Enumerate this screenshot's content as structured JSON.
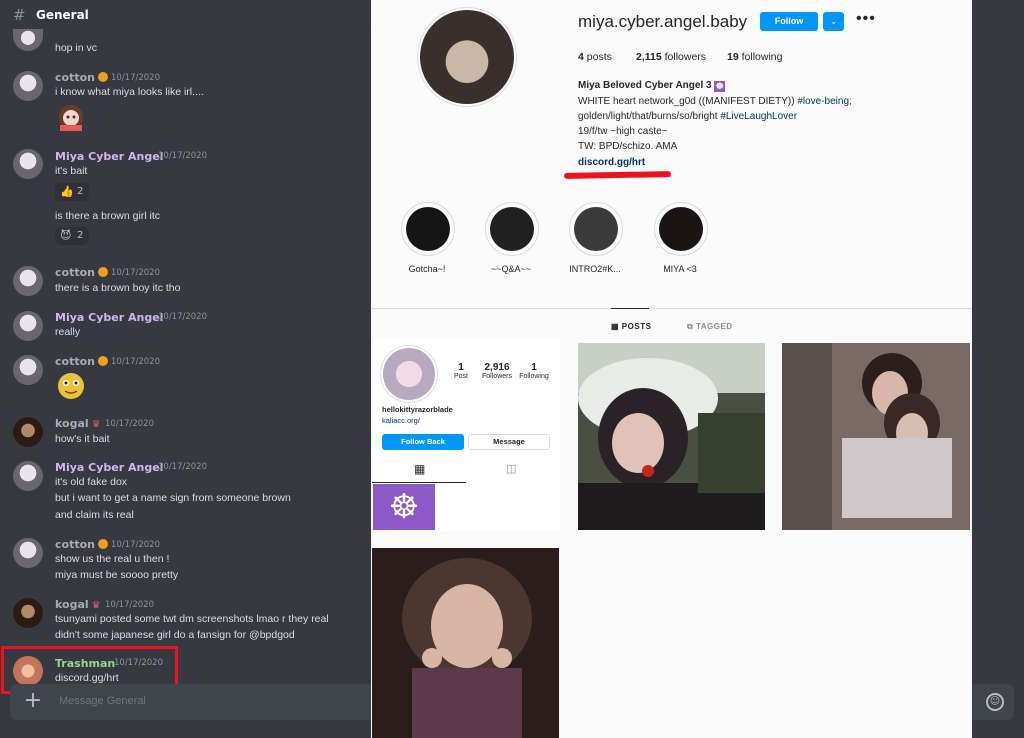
{
  "discord": {
    "channel_hash": "#",
    "channel_name": "General",
    "input_placeholder": "Message General",
    "messages": [
      {
        "line1": "hop in vc"
      },
      {
        "user": "cotton",
        "time": "10/17/2020",
        "line1": "i know what miya looks like irl...."
      },
      {
        "user": "Miya Cyber Angel",
        "time": "10/17/2020",
        "line1": "it's bait",
        "react1_emoji": "👍",
        "react1_count": "2",
        "line2": "is there a brown girl itc",
        "react2_emoji": "😈",
        "react2_count": "2"
      },
      {
        "user": "cotton",
        "time": "10/17/2020",
        "line1": "there is a brown boy itc tho"
      },
      {
        "user": "Miya Cyber Angel",
        "time": "10/17/2020",
        "line1": "really"
      },
      {
        "user": "cotton",
        "time": "10/17/2020"
      },
      {
        "user": "kogal",
        "time": "10/17/2020",
        "line1": "how's it bait"
      },
      {
        "user": "Miya Cyber Angel",
        "time": "10/17/2020",
        "line1": "it's old fake dox",
        "line2": "but i want to get a name sign from someone brown",
        "line3": "and claim its real"
      },
      {
        "user": "cotton",
        "time": "10/17/2020",
        "line1": "show us the real u then !",
        "line2": "miya must be soooo pretty"
      },
      {
        "user": "kogal",
        "time": "10/17/2020",
        "line1": "tsunyami posted some twt dm screenshots lmao r they real",
        "line2": "didn't some japanese girl do a fansign for @bpdgod"
      },
      {
        "user": "Trashman",
        "time": "10/17/2020",
        "line1": "discord.gg/hrt"
      }
    ],
    "colors": {
      "bg": "#36393f",
      "highlight_box": "#e8141e"
    }
  },
  "instagram": {
    "username": "miya.cyber.angel.baby",
    "follow_label": "Follow",
    "dropdown_icon": "chevron-down-icon",
    "more_label": "•••",
    "posts_count": "4",
    "posts_label": "posts",
    "followers_count": "2,115",
    "followers_label": "followers",
    "following_count": "19",
    "following_label": "following",
    "bio_name": "Miya Beloved Cyber Angel 3",
    "bio_line1": "WHITE heart network_g0d ((MANIFEST DIETY))",
    "bio_tag1": "#love-being;",
    "bio_line2": "golden/light/that/burns/so/bright",
    "bio_tag2": "#LiveLaughLover",
    "bio_line3": "19/f/tw ~high caste~",
    "bio_line4": "TW: BPD/schizo. AMA",
    "bio_link": "discord.gg/hrt",
    "highlights": [
      "Gotcha~!",
      "~~Q&A~~",
      "INTRO2#K...",
      "MIYA <3"
    ],
    "tab_posts": "POSTS",
    "tab_tagged": "TAGGED",
    "mini_profile": {
      "posts_count": "1",
      "posts_label": "Post",
      "followers_count": "2,916",
      "followers_label": "Followers",
      "following_count": "1",
      "following_label": "Following",
      "username": "hellokittyrazorblade",
      "link": "kaliacc.org/",
      "follow_back_label": "Follow Back",
      "message_label": "Message"
    },
    "colors": {
      "accent": "#0095f6",
      "redline": "#e8141e"
    }
  }
}
